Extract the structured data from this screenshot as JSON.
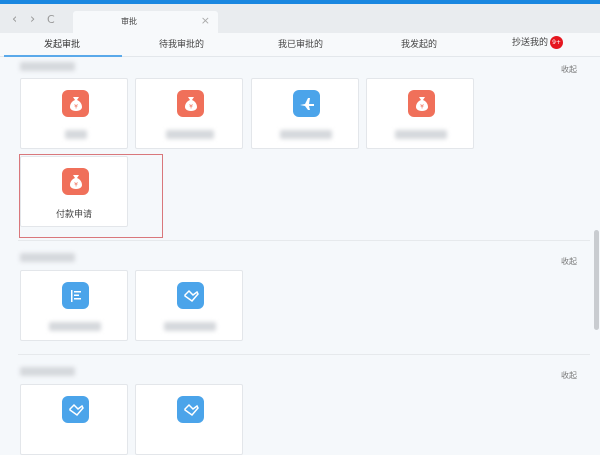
{
  "browser": {
    "tab_title": "审批",
    "close": "×",
    "back": "‹",
    "forward": "›",
    "reload": "C"
  },
  "tabs": [
    {
      "label": "发起审批"
    },
    {
      "label": "待我审批的"
    },
    {
      "label": "我已审批的"
    },
    {
      "label": "我发起的"
    },
    {
      "label": "抄送我的",
      "badge": "9+"
    }
  ],
  "sections": [
    {
      "collapse": "收起"
    },
    {
      "collapse": "收起"
    },
    {
      "collapse": "收起"
    }
  ],
  "highlighted_card": {
    "label": "付款申请",
    "icon": "money-bag-icon"
  },
  "colors": {
    "accent": "#1a87e0",
    "orange_icon": "#f0705a",
    "blue_icon": "#4ba4ea",
    "highlight": "#d9777b",
    "badge": "#e5161f"
  }
}
